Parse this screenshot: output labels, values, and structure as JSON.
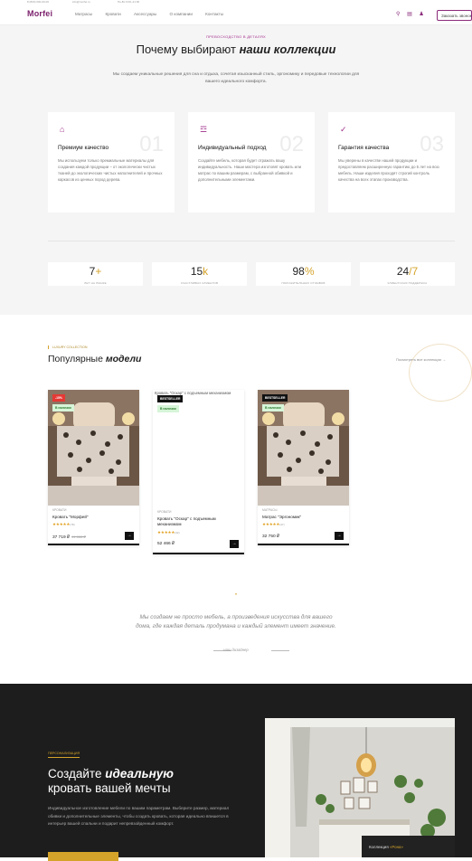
{
  "topbar": {
    "left": "8 (800) 000-00-00",
    "mid": "info@morfei.ru",
    "right": "Пн-Вс 9:00–21:00"
  },
  "header": {
    "logo": "Morfei",
    "nav": [
      "Матрасы",
      "Кровати",
      "Аксессуары",
      "О компании",
      "Контакты"
    ],
    "call_button": "Заказать звонок"
  },
  "why": {
    "kicker": "ПРЕВОСХОДСТВО В ДЕТАЛЯХ",
    "title_plain": "Почему выбирают",
    "title_em": "наши коллекции",
    "lead": "Мы создаем уникальные решения для сна и отдыха, сочетая изысканный стиль, эргономику и передовые технологии для вашего идеального комфорта.",
    "cards": [
      {
        "num": "01",
        "title": "Премиум качество",
        "text": "Мы используем только премиальные материалы для создания каждой продукции – от экологически чистых тканей до экологических чистых наполнителей и прочных каркасов из ценных пород дерева."
      },
      {
        "num": "02",
        "title": "Индивидуальный подход",
        "text": "Создайте мебель, которая будет отражать вашу индивидуальность. Наши мастера изготовят кровать или матрас по вашим размерам, с выбранной обивкой и дополнительными элементами."
      },
      {
        "num": "03",
        "title": "Гарантия качества",
        "text": "Мы уверены в качестве нашей продукции и предоставляем расширенную гарантию до 5 лет на всю мебель. Наши изделия проходят строгий контроль качества на всех этапах производства."
      }
    ],
    "stats": [
      {
        "num": "7",
        "suffix": "+",
        "label": "ЛЕТ НА РЫНКЕ"
      },
      {
        "num": "15",
        "suffix": "k",
        "label": "СЧАСТЛИВЫХ КЛИЕНТОВ"
      },
      {
        "num": "98",
        "suffix": "%",
        "label": "ПОЛОЖИТЕЛЬНЫХ ОТЗЫВОВ"
      },
      {
        "num": "24",
        "suffix": "/7",
        "label": "КЛИЕНТСКАЯ ПОДДЕРЖКА"
      }
    ]
  },
  "popular": {
    "kicker": "LUXURY COLLECTION",
    "title_plain": "Популярные",
    "title_em": "модели",
    "view_all": "Посмотреть все коллекции →",
    "products": [
      {
        "badge_top": "-15%",
        "badge_stock": "В наличии",
        "category": "КРОВАТИ",
        "name": "Кровать \"Морфей\"",
        "stars": "★★★★★",
        "reviews": "(78)",
        "price": "37 719 ₽",
        "old_price": "41 888 ₽",
        "broken_alt": ""
      },
      {
        "badge_top": "BESTSELLER",
        "badge_stock": "В наличии",
        "category": "КРОВАТИ",
        "name": "Кровать \"Оскар\" с подъемным механизмом",
        "stars": "★★★★★",
        "reviews": "(32)",
        "price": "52 466 ₽",
        "old_price": "",
        "broken_alt": "Кровать \"Оскар\" с подъемным механизмом"
      },
      {
        "badge_top": "BESTSELLER",
        "badge_stock": "В наличии",
        "category": "МАТРАСЫ",
        "name": "Матрас \"Эргономик\"",
        "stars": "★★★★★",
        "reviews": "(47)",
        "price": "32 750 ₽",
        "old_price": "",
        "broken_alt": ""
      }
    ]
  },
  "quote": {
    "mark": "\"",
    "text": "Мы создаем не просто мебель, а произведения искусства для вашего дома, где каждая деталь продумана и каждый элемент имеет значение.",
    "author": "наш дизайнер"
  },
  "custom": {
    "kicker": "ПЕРСОНАЛИЗАЦИЯ",
    "title_line1_plain": "Создайте",
    "title_line1_em": "идеальную",
    "title_line2": "кровать вашей мечты",
    "text": "Индивидуальное изготовление мебели по вашим параметрам. Выберите размер, материал обивки и дополнительные элементы, чтобы создать кровать, которая идеально впишется в интерьер вашей спальни и подарит непревзойденный комфорт.",
    "caption_prefix": "Коллекция",
    "caption_name": "«Рона»"
  },
  "colors": {
    "accent": "#a0308a",
    "gold": "#d4a32a",
    "dark": "#1d1d1d"
  }
}
